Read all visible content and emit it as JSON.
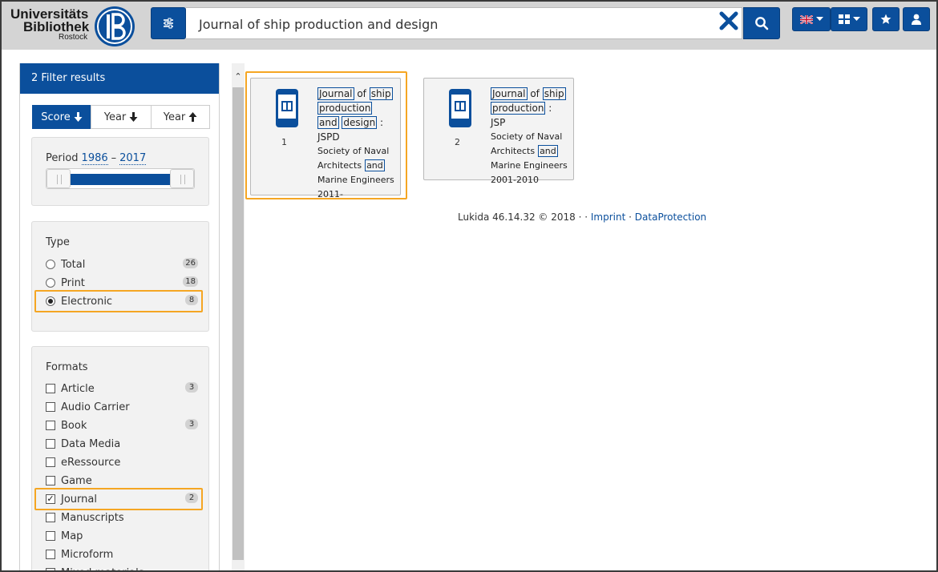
{
  "logo": {
    "line1": "Universitäts",
    "line2": "Bibliothek",
    "line3": "Rostock"
  },
  "search": {
    "value": "Journal of ship production and design"
  },
  "sidebar": {
    "header": "2 Filter results",
    "sort": [
      {
        "label": "Score",
        "icon": "arrow-down-icon",
        "active": true
      },
      {
        "label": "Year",
        "icon": "arrow-down-icon",
        "active": false
      },
      {
        "label": "Year",
        "icon": "arrow-up-icon",
        "active": false
      }
    ],
    "period": {
      "label": "Period",
      "from": "1986",
      "sep": "–",
      "to": "2017"
    },
    "type": {
      "title": "Type",
      "options": [
        {
          "label": "Total",
          "count": "26",
          "checked": false
        },
        {
          "label": "Print",
          "count": "18",
          "checked": false
        },
        {
          "label": "Electronic",
          "count": "8",
          "checked": true
        }
      ]
    },
    "formats": {
      "title": "Formats",
      "options": [
        {
          "label": "Article",
          "count": "3",
          "checked": false
        },
        {
          "label": "Audio Carrier",
          "count": "",
          "checked": false
        },
        {
          "label": "Book",
          "count": "3",
          "checked": false
        },
        {
          "label": "Data Media",
          "count": "",
          "checked": false
        },
        {
          "label": "eRessource",
          "count": "",
          "checked": false
        },
        {
          "label": "Game",
          "count": "",
          "checked": false
        },
        {
          "label": "Journal",
          "count": "2",
          "checked": true
        },
        {
          "label": "Manuscripts",
          "count": "",
          "checked": false
        },
        {
          "label": "Map",
          "count": "",
          "checked": false
        },
        {
          "label": "Microform",
          "count": "",
          "checked": false
        },
        {
          "label": "Mixed materials",
          "count": "",
          "checked": false
        }
      ]
    }
  },
  "results": [
    {
      "number": "1",
      "title_words": [
        "Journal",
        "of",
        "ship",
        "production",
        "and",
        "design"
      ],
      "title_suffix": ": JSPD",
      "publisher_lines": [
        "Society of Naval",
        "Architects",
        "and",
        "Marine Engineers",
        "2011-"
      ]
    },
    {
      "number": "2",
      "title_words": [
        "Journal",
        "of",
        "ship",
        "production"
      ],
      "title_suffix": ": JSP",
      "publisher_lines": [
        "Society of Naval",
        "Architects",
        "and",
        "Marine Engineers",
        "2001-2010"
      ]
    }
  ],
  "footer": {
    "version": "Lukida 46.14.32 © 2018 ·",
    "dot": "·",
    "imprint": "Imprint",
    "sep": "·",
    "privacy": "DataProtection"
  },
  "colors": {
    "brand": "#0b4f9c",
    "highlight": "#f5a623",
    "header_bg": "#d4d4d4"
  }
}
